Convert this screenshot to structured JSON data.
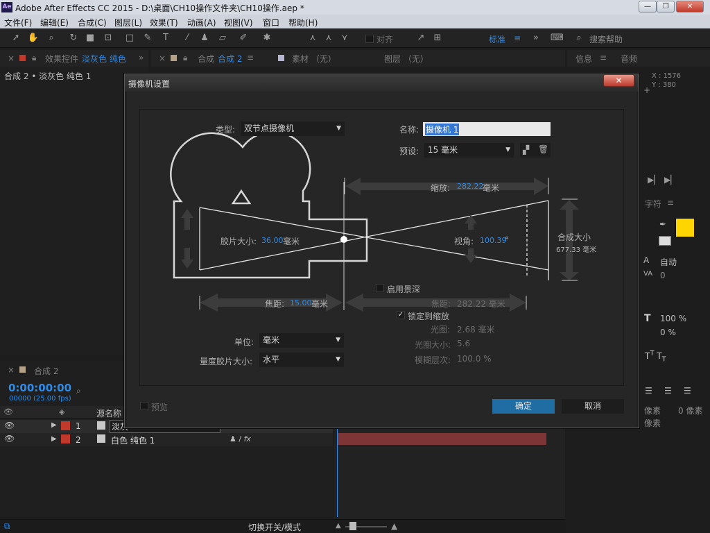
{
  "window": {
    "app_icon": "Ae",
    "title": "Adobe After Effects CC 2015 - D:\\桌面\\CH10操作文件夹\\CH10操作.aep *",
    "min_label": "—",
    "max_label": "❐",
    "close_label": "✕"
  },
  "menu": [
    "文件(F)",
    "编辑(E)",
    "合成(C)",
    "图层(L)",
    "效果(T)",
    "动画(A)",
    "视图(V)",
    "窗口",
    "帮助(H)"
  ],
  "toolbar": {
    "snap_label": "对齐",
    "workspace": "标准",
    "search_placeholder": "搜索帮助"
  },
  "effects_panel": {
    "tab_label": "效果控件",
    "tab_layer": "淡灰色 纯色",
    "breadcrumb": "合成 2 • 淡灰色 纯色 1"
  },
  "comp_panel": {
    "tab_prefix": "合成",
    "tab_name": "合成 2",
    "footage_tab": "素材 （无）",
    "layer_tab": "图层 （无）"
  },
  "info_panel": {
    "tab_info": "信息",
    "tab_audio": "音频",
    "x": "X : 1576",
    "y": "Y : 380"
  },
  "character_panel": {
    "tab": "字符",
    "leading": "自动",
    "tracking": "0",
    "vscale": "100 %",
    "baseline": "0 %",
    "para_indent_left": "像素",
    "para_indent_right": "0 像素",
    "para_space": "像素",
    "swatch_color": "#ffd500"
  },
  "timeline": {
    "tab": "合成 2",
    "timecode": "0:00:00:00",
    "frames": "00000 (25.00 fps)",
    "col_source": "源名称",
    "rows": [
      {
        "num": "1",
        "name": "淡灰",
        "color": "#c0392b"
      },
      {
        "num": "2",
        "name": "白色 纯色 1",
        "color": "#c0392b"
      }
    ],
    "switch_mode": "切换开关/模式"
  },
  "dialog": {
    "title": "摄像机设置",
    "close": "✕",
    "type_label": "类型:",
    "type_value": "双节点摄像机",
    "name_label": "名称:",
    "name_value": "摄像机 1",
    "preset_label": "预设:",
    "preset_value": "15 毫米",
    "zoom_label": "缩放:",
    "zoom_value": "282.22",
    "zoom_unit": "毫米",
    "film_label": "胶片大小:",
    "film_value": "36.00",
    "film_unit": "毫米",
    "angle_label": "视角:",
    "angle_value": "100.39",
    "angle_unit": "°",
    "comp_size_label": "合成大小",
    "comp_size_value": "677.33 毫米",
    "dof_label": "启用景深",
    "focal_label": "焦距:",
    "focal_value": "15.00",
    "focal_unit": "毫米",
    "focus_dist_label": "焦距:",
    "focus_dist_value": "282.22 毫米",
    "lock_label": "锁定到缩放",
    "aperture_label": "光圈:",
    "aperture_value": "2.68 毫米",
    "fstop_label": "光圈大小:",
    "fstop_value": "5.6",
    "blur_label": "模糊层次:",
    "blur_value": "100.0 %",
    "units_label": "单位:",
    "units_value": "毫米",
    "measure_label": "量度胶片大小:",
    "measure_value": "水平",
    "preview_label": "预览",
    "ok": "确定",
    "cancel": "取消"
  }
}
